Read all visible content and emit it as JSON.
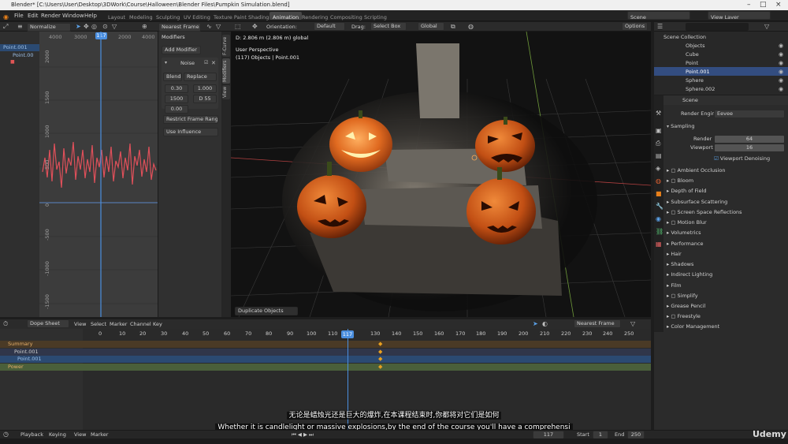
{
  "window": {
    "title": "Blender* [C:\\Users\\User\\Desktop\\3DWork\\Course\\Halloween\\Blender Files\\Pumpkin Simulation.blend]"
  },
  "menu": {
    "items": [
      "File",
      "Edit",
      "Render",
      "Window",
      "Help"
    ]
  },
  "workspaces": [
    "Layout",
    "Modeling",
    "Sculpting",
    "UV Editing",
    "Texture Paint",
    "Shading",
    "Animation",
    "Rendering",
    "Compositing",
    "Scripting"
  ],
  "top_right": {
    "scene": "Scene",
    "view_layer": "View Layer"
  },
  "graph": {
    "normalize": "Normalize",
    "frame": "117",
    "x_ticks": [
      "4000",
      "3000",
      "2000",
      "4000"
    ],
    "y_ticks": [
      "2000",
      "1500",
      "1000",
      "500",
      "0",
      "-500",
      "-1000",
      "-1500"
    ],
    "channels": [
      "Point.001",
      "Point.00"
    ]
  },
  "modifiers": {
    "nearest_frame": "Nearest Frame",
    "header": "Modifiers",
    "add_label": "Add Modifier",
    "noise_name": "Noise",
    "blend_label": "Blend...",
    "blend_value": "Replace",
    "scale": "0.30",
    "strength": "1.000",
    "phase": "1500",
    "depth": "D   55",
    "offset": "0.00",
    "restrict": "Restrict Frame Range",
    "influence": "Use Influence",
    "tabs": [
      "F-Curve",
      "Modifiers",
      "View"
    ]
  },
  "viewport": {
    "orientation_label": "Orientation:",
    "orientation": "Default",
    "drag_label": "Drag:",
    "drag": "Select Box",
    "global": "Global",
    "options": "Options",
    "d_info": "D: 2.806 m (2.806 m) global",
    "perspective": "User Perspective",
    "objects_info": "(117) Objects | Point.001",
    "last_op": "Duplicate Objects"
  },
  "outliner": {
    "items": [
      {
        "label": "Scene Collection"
      },
      {
        "label": "Objects"
      },
      {
        "label": "Cube"
      },
      {
        "label": "Point"
      },
      {
        "label": "Point.001",
        "selected": true
      },
      {
        "label": "Sphere"
      },
      {
        "label": "Sphere.002"
      }
    ]
  },
  "properties": {
    "scene": "Scene",
    "render_engine_label": "Render Engine",
    "render_engine": "Eevee",
    "sampling": "Sampling",
    "render_label": "Render",
    "render_value": "64",
    "viewport_label": "Viewport",
    "viewport_value": "16",
    "denoise": "Viewport Denoising",
    "sections": [
      "Ambient Occlusion",
      "Bloom",
      "Depth of Field",
      "Subsurface Scattering",
      "Screen Space Reflections",
      "Motion Blur",
      "Volumetrics",
      "Performance",
      "Hair",
      "Shadows",
      "Indirect Lighting",
      "Film",
      "Simplify",
      "Grease Pencil",
      "Freestyle",
      "Color Management"
    ]
  },
  "dopesheet": {
    "mode": "Dope Sheet",
    "menus": [
      "View",
      "Select",
      "Marker",
      "Channel",
      "Key"
    ],
    "snap": "Nearest Frame",
    "frame": "117",
    "ticks": [
      "0",
      "10",
      "20",
      "30",
      "40",
      "50",
      "60",
      "70",
      "80",
      "90",
      "100",
      "110",
      "117",
      "130",
      "140",
      "150",
      "160",
      "170",
      "180",
      "190",
      "200",
      "210",
      "220",
      "230",
      "240",
      "250"
    ],
    "channels": [
      "Summary",
      "Point.001",
      "Point.001",
      "Power"
    ]
  },
  "timeline": {
    "menus": [
      "Playback",
      "Keying",
      "View",
      "Marker"
    ],
    "current": "117",
    "start_label": "Start",
    "start": "1",
    "end_label": "End",
    "end": "250"
  },
  "subtitles": {
    "cn": "无论是蜡烛光还是巨大的爆炸,在本课程结束时,你都将对它们是如何",
    "en": "Whether it is candlelight or massive explosions,by the end of the course you'll have a comprehensi"
  },
  "watermark": "Udemy",
  "colors": {
    "accent": "#4772b3",
    "curve": "#e0505a",
    "playhead": "#4b8fe0",
    "orange": "#e8801a"
  }
}
